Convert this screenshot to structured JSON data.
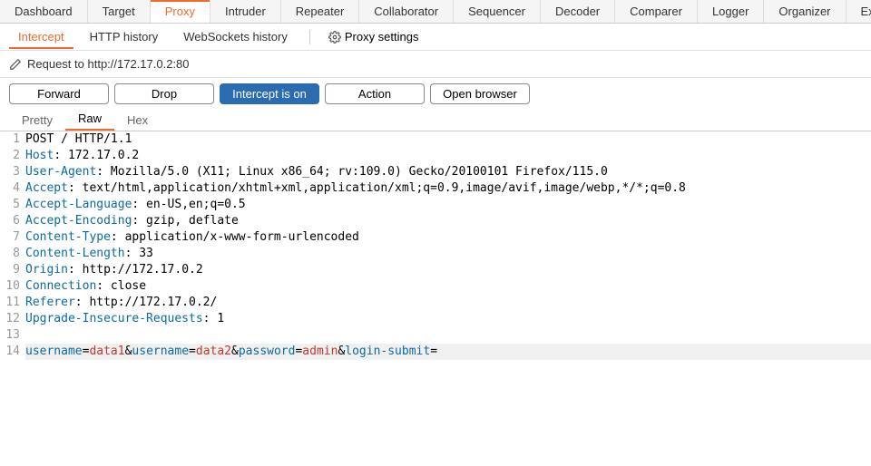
{
  "topTabs": [
    {
      "label": "Dashboard"
    },
    {
      "label": "Target"
    },
    {
      "label": "Proxy",
      "active": true
    },
    {
      "label": "Intruder"
    },
    {
      "label": "Repeater"
    },
    {
      "label": "Collaborator"
    },
    {
      "label": "Sequencer"
    },
    {
      "label": "Decoder"
    },
    {
      "label": "Comparer"
    },
    {
      "label": "Logger"
    },
    {
      "label": "Organizer"
    },
    {
      "label": "Ext"
    }
  ],
  "subTabs": {
    "items": [
      {
        "label": "Intercept",
        "active": true
      },
      {
        "label": "HTTP history"
      },
      {
        "label": "WebSockets history"
      }
    ],
    "settings": "Proxy settings"
  },
  "request": {
    "label": "Request to http://172.17.0.2:80"
  },
  "buttons": {
    "forward": "Forward",
    "drop": "Drop",
    "intercept": "Intercept is on",
    "action": "Action",
    "open": "Open browser"
  },
  "viewTabs": [
    {
      "label": "Pretty"
    },
    {
      "label": "Raw",
      "active": true
    },
    {
      "label": "Hex"
    }
  ],
  "http": {
    "requestLine": "POST / HTTP/1.1",
    "headers": [
      {
        "name": "Host",
        "value": " 172.17.0.2"
      },
      {
        "name": "User-Agent",
        "value": " Mozilla/5.0 (X11; Linux x86_64; rv:109.0) Gecko/20100101 Firefox/115.0"
      },
      {
        "name": "Accept",
        "value": " text/html,application/xhtml+xml,application/xml;q=0.9,image/avif,image/webp,*/*;q=0.8"
      },
      {
        "name": "Accept-Language",
        "value": " en-US,en;q=0.5"
      },
      {
        "name": "Accept-Encoding",
        "value": " gzip, deflate"
      },
      {
        "name": "Content-Type",
        "value": " application/x-www-form-urlencoded"
      },
      {
        "name": "Content-Length",
        "value": " 33"
      },
      {
        "name": "Origin",
        "value": " http://172.17.0.2"
      },
      {
        "name": "Connection",
        "value": " close"
      },
      {
        "name": "Referer",
        "value": " http://172.17.0.2/"
      },
      {
        "name": "Upgrade-Insecure-Requests",
        "value": " 1"
      }
    ],
    "body": [
      {
        "name": "username",
        "value": "data1"
      },
      {
        "name": "username",
        "value": "data2"
      },
      {
        "name": "password",
        "value": "admin"
      },
      {
        "name": "login-submit",
        "value": ""
      }
    ]
  }
}
